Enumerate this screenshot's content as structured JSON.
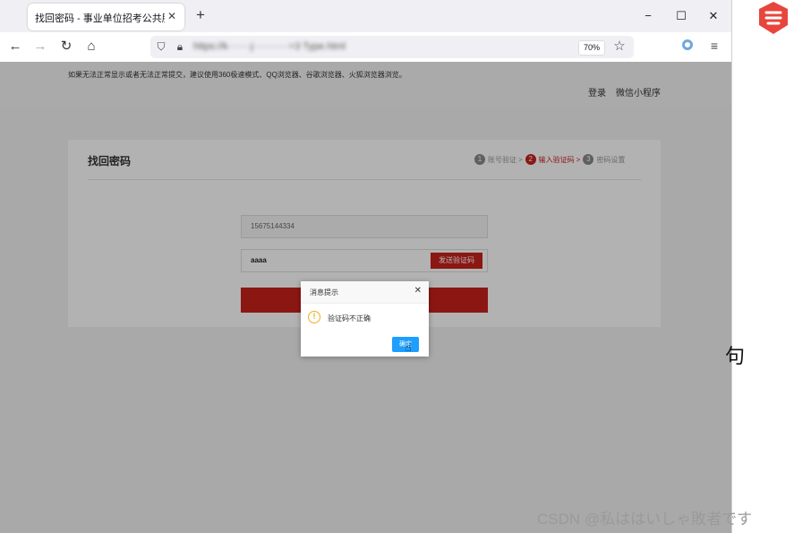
{
  "browser": {
    "tab_title": "找回密码 - 事业单位招考公共服务平",
    "tab_close": "✕",
    "new_tab": "+",
    "url_text": "https://k·······j···········=3 Type.html",
    "zoom": "70%",
    "window_controls": {
      "minimize": "−",
      "maximize": "☐",
      "close": "✕"
    },
    "icons": [
      "back-icon",
      "forward-icon",
      "reload-icon",
      "home-icon",
      "shield-icon",
      "lock-icon",
      "star-icon",
      "extension-icon",
      "menu-icon"
    ]
  },
  "site": {
    "notice": "如果无法正常显示或者无法正常提交，建议使用360极速模式、QQ浏览器、谷歌浏览器、火狐浏览器浏览。",
    "login": "登录",
    "mini_program": "微信小程序"
  },
  "card": {
    "title": "找回密码",
    "steps": [
      {
        "num": "1",
        "label": "账号验证"
      },
      {
        "num": "2",
        "label": "输入验证码"
      },
      {
        "num": "3",
        "label": "密码设置"
      }
    ],
    "step_sep": ">",
    "phone": "15675144334",
    "code": "aaaa",
    "send_code": "发送验证码",
    "accent_color": "#c8221c"
  },
  "dialog": {
    "title": "消息提示",
    "close": "✕",
    "message": "验证码不正确",
    "ok": "确定",
    "warning_symbol": "!"
  },
  "outside": {
    "glyph": "句",
    "watermark": "CSDN @私ははいしゃ敗者です"
  }
}
